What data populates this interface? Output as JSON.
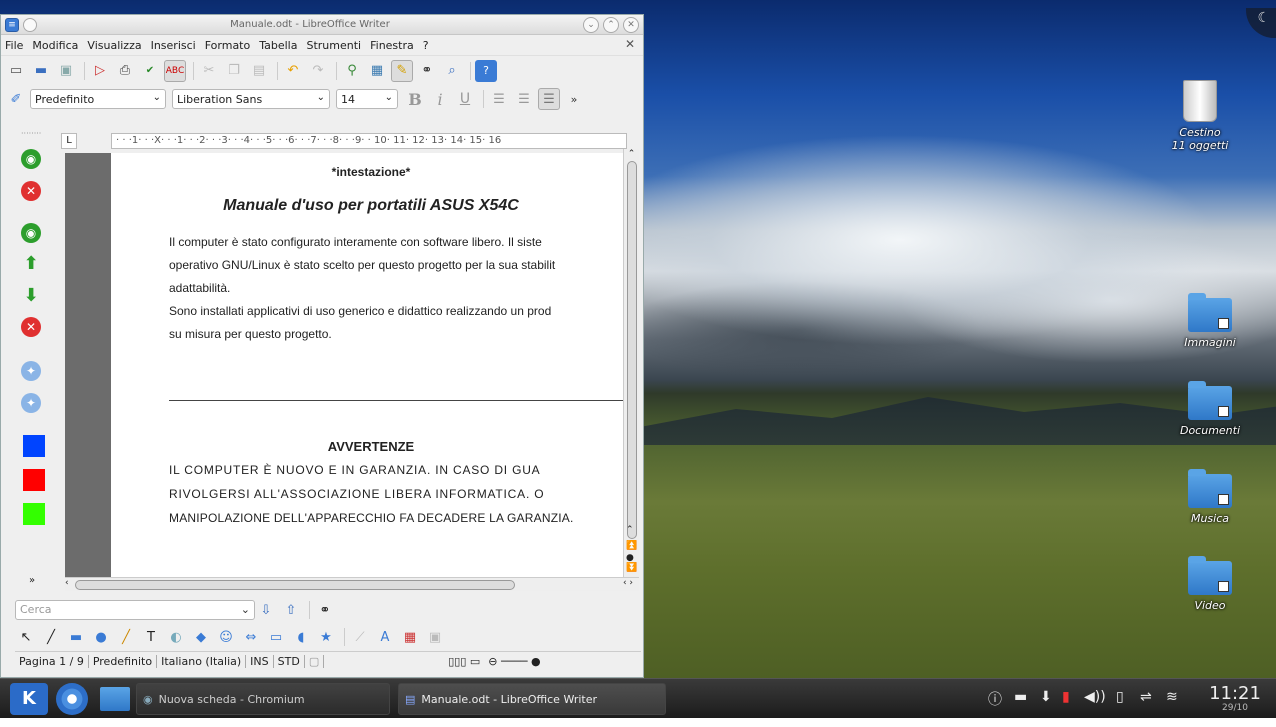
{
  "window": {
    "title": "Manuale.odt - LibreOffice Writer",
    "menu": [
      "File",
      "Modifica",
      "Visualizza",
      "Inserisci",
      "Formato",
      "Tabella",
      "Strumenti",
      "Finestra",
      "?"
    ]
  },
  "format_toolbar": {
    "style": "Predefinito",
    "font": "Liberation Sans",
    "size": "14"
  },
  "ruler": "· · ·1· · ·X· · ·1· · ·2· · ·3· · ·4· · ·5· · ·6· · ·7· · ·8· · ·9· · 10· 11· 12· 13· 14· 15· 16",
  "document": {
    "header": "*intestazione*",
    "title": "Manuale d'uso per portatili ASUS X54C",
    "para1": [
      "Il computer è stato configurato interamente con software libero. Il siste",
      "operativo GNU/Linux è stato scelto per questo progetto per la sua stabilit",
      "adattabilità.",
      "Sono installati applicativi di uso generico e didattico realizzando un prod",
      "su misura per questo progetto."
    ],
    "warning_title": "AVVERTENZE",
    "warning": [
      "IL COMPUTER È NUOVO E IN GARANZIA. IN CASO DI GUA",
      "RIVOLGERSI ALL'ASSOCIAZIONE LIBERA INFORMATICA. O",
      "MANIPOLAZIONE DELL'APPARECCHIO FA DECADERE LA GARANZIA."
    ]
  },
  "find": {
    "placeholder": "Cerca"
  },
  "status": {
    "page": "Pagina 1 / 9",
    "style": "Predefinito",
    "language": "Italiano (Italia)",
    "ins": "INS",
    "std": "STD"
  },
  "desktop_icons": [
    {
      "label": "Cestino",
      "sub": "11 oggetti"
    },
    {
      "label": "Immagini"
    },
    {
      "label": "Documenti"
    },
    {
      "label": "Musica"
    },
    {
      "label": "Video"
    }
  ],
  "taskbar": {
    "tasks": [
      "Nuova scheda - Chromium",
      "Manuale.odt - LibreOffice Writer"
    ],
    "clock": "11:21",
    "date": "29/10"
  },
  "colors": {
    "sidebar_blue": "#0044ff",
    "sidebar_red": "#ff0000",
    "sidebar_green": "#33ff00"
  }
}
